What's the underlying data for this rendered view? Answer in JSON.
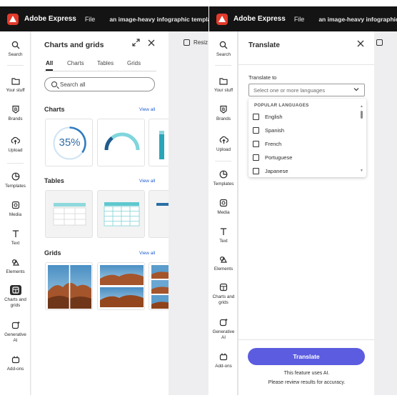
{
  "app": {
    "name": "Adobe Express",
    "file_menu": "File",
    "doc_title": "an image-heavy infographic template wi",
    "doc_title_right": "an image-heavy infographic template"
  },
  "rail_left": [
    {
      "label": "Search",
      "icon": "search-icon"
    },
    {
      "label": "Your stuff",
      "icon": "folder-icon"
    },
    {
      "label": "Brands",
      "icon": "brand-icon"
    },
    {
      "label": "Upload",
      "icon": "upload-icon"
    },
    {
      "label": "Templates",
      "icon": "templates-icon"
    },
    {
      "label": "Media",
      "icon": "media-icon"
    },
    {
      "label": "Text",
      "icon": "text-icon"
    },
    {
      "label": "Elements",
      "icon": "elements-icon"
    },
    {
      "label": "Charts and grids",
      "icon": "charts-grids-icon"
    },
    {
      "label": "Generative AI",
      "icon": "generative-ai-icon"
    },
    {
      "label": "Add-ons",
      "icon": "addons-icon"
    }
  ],
  "rail_right": [
    {
      "label": "Search",
      "icon": "search-icon"
    },
    {
      "label": "Your stuff",
      "icon": "folder-icon"
    },
    {
      "label": "Brands",
      "icon": "brand-icon"
    },
    {
      "label": "Upload",
      "icon": "upload-icon"
    },
    {
      "label": "Templates",
      "icon": "templates-icon"
    },
    {
      "label": "Media",
      "icon": "media-icon"
    },
    {
      "label": "Text",
      "icon": "text-icon"
    },
    {
      "label": "Elements",
      "icon": "elements-icon"
    },
    {
      "label": "Charts and grids",
      "icon": "charts-grids-icon"
    },
    {
      "label": "Generative AI",
      "icon": "generative-ai-icon"
    },
    {
      "label": "Add-ons",
      "icon": "addons-icon"
    }
  ],
  "charts_panel": {
    "title": "Charts and grids",
    "tabs": [
      "All",
      "Charts",
      "Tables",
      "Grids"
    ],
    "active_tab": "All",
    "search_placeholder": "Search all",
    "sections": {
      "charts": {
        "title": "Charts",
        "view_all": "View all"
      },
      "tables": {
        "title": "Tables",
        "view_all": "View all"
      },
      "grids": {
        "title": "Grids",
        "view_all": "View all"
      }
    },
    "chart_thumb_percent": "35%"
  },
  "canvas": {
    "resize_label": "Resiz"
  },
  "translate_panel": {
    "title": "Translate",
    "label": "Translate to",
    "placeholder": "Select one or more languages",
    "dropdown_heading": "POPULAR LANGUAGES",
    "languages": [
      "English",
      "Spanish",
      "French",
      "Portuguese",
      "Japanese"
    ],
    "button": "Translate",
    "note1": "This feature uses AI.",
    "note2": "Please review results for accuracy."
  },
  "colors": {
    "accent": "#5c5ce0",
    "topbar": "#141414",
    "teal": "#6dcbd3",
    "ring": "#2e7bbf"
  }
}
